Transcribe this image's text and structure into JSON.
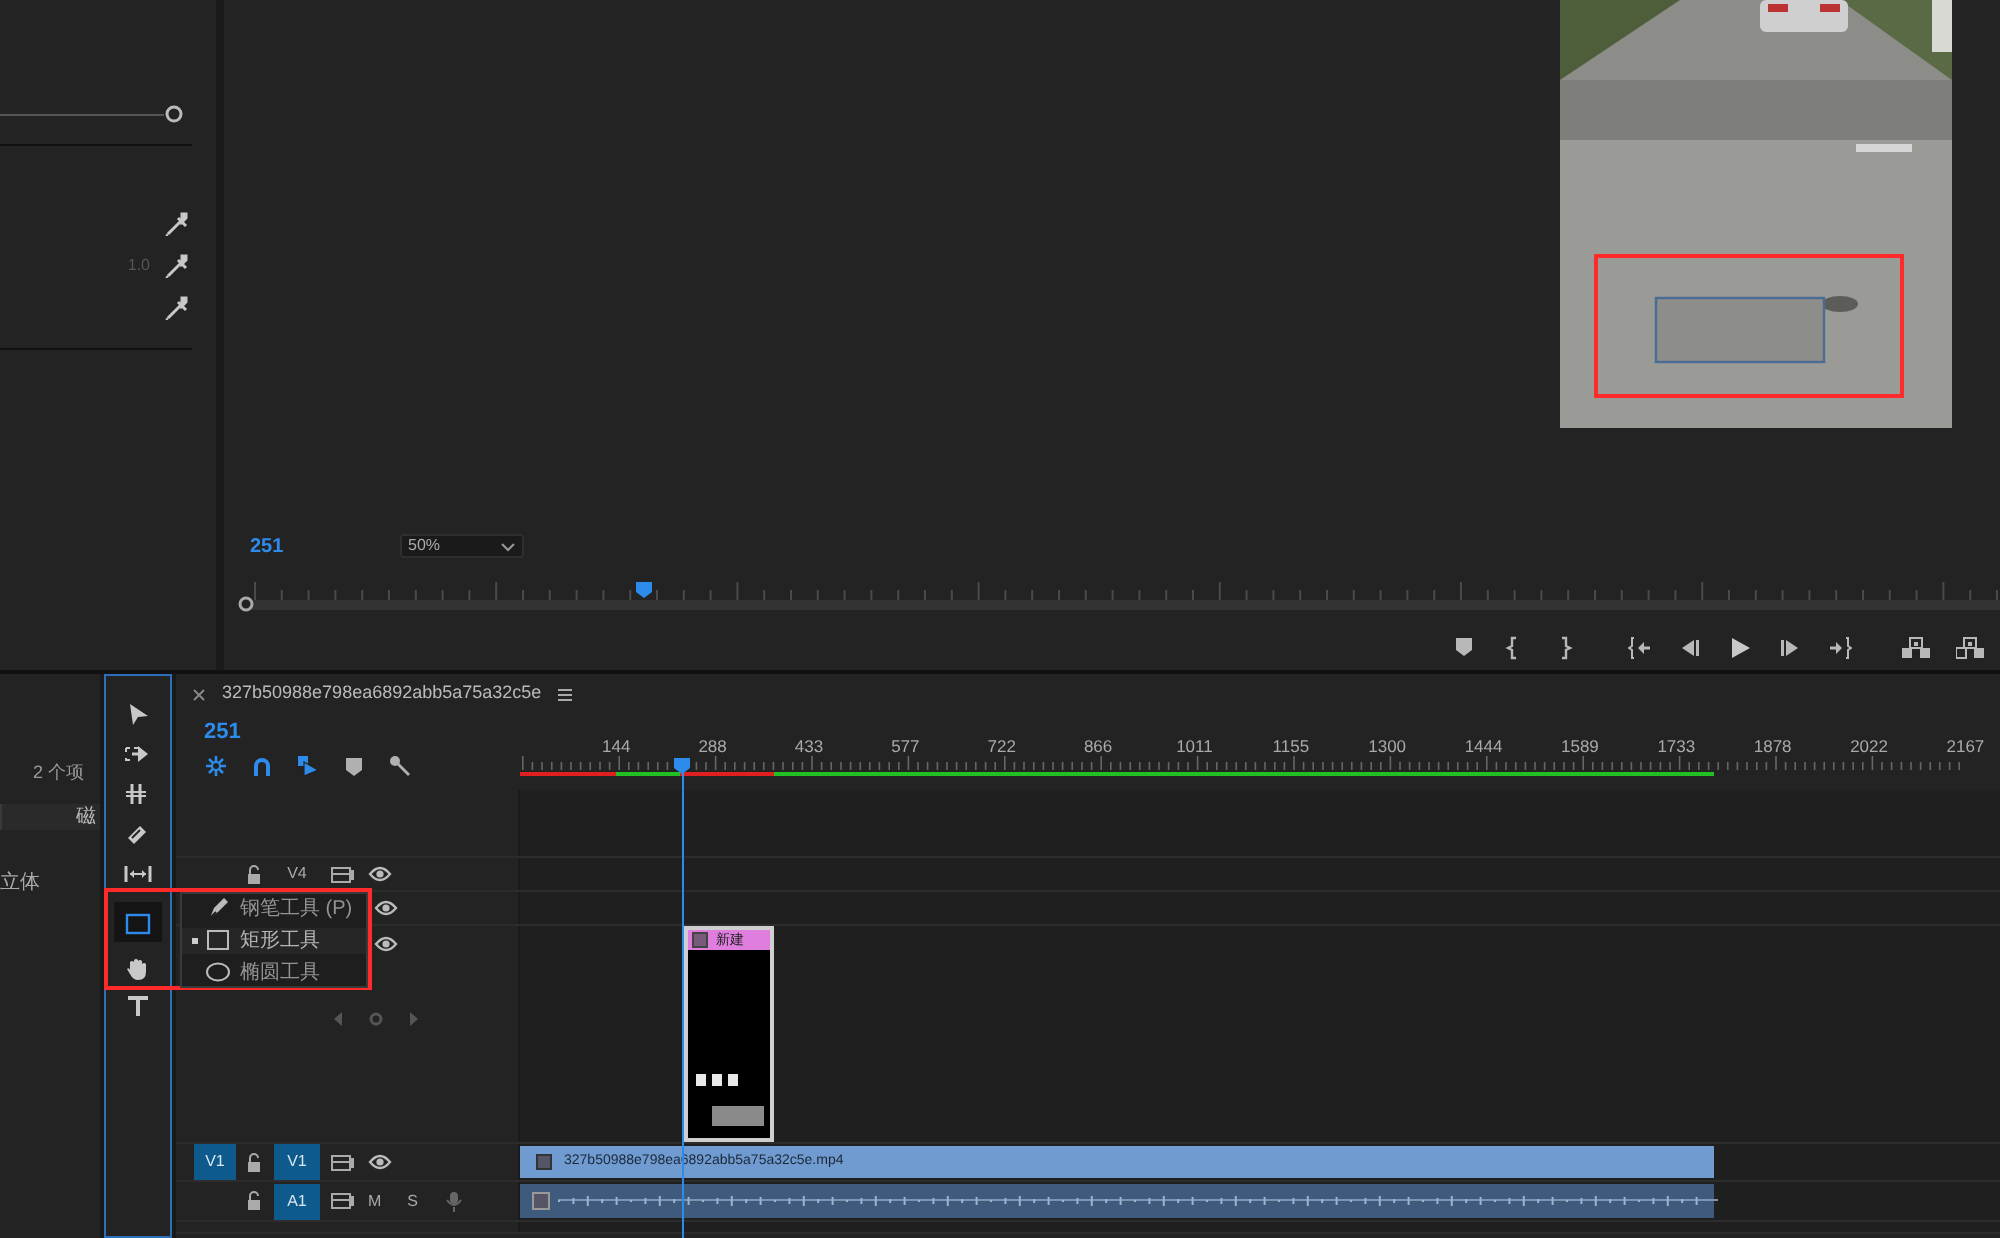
{
  "effect_controls": {
    "value": "1.0"
  },
  "program_monitor": {
    "timecode": "251",
    "zoom": "50%",
    "scrubber": {
      "level": 0.23
    },
    "controls": [
      {
        "kind": "marker"
      },
      {
        "kind": "mark-in"
      },
      {
        "kind": "mark-out"
      },
      {
        "kind": "go-to-in"
      },
      {
        "kind": "step-back"
      },
      {
        "kind": "play"
      },
      {
        "kind": "step-forward"
      },
      {
        "kind": "go-to-out"
      },
      {
        "kind": "lift"
      },
      {
        "kind": "extract"
      }
    ]
  },
  "project_panel": {
    "item_count": "2 个项",
    "column_header": "磁",
    "row_label": "立体"
  },
  "tools": [
    {
      "kind": "select",
      "selected": false
    },
    {
      "kind": "track-select",
      "selected": false
    },
    {
      "kind": "ripple",
      "selected": false
    },
    {
      "kind": "razor",
      "selected": false
    },
    {
      "kind": "slip",
      "selected": false
    },
    {
      "kind": "rectangle",
      "selected": true
    },
    {
      "kind": "hand",
      "selected": false
    },
    {
      "kind": "type",
      "selected": false
    }
  ],
  "tool_menu": [
    {
      "kind": "pen",
      "label": "钢笔工具 (P)",
      "selected": false
    },
    {
      "kind": "rectangle",
      "label": "矩形工具",
      "selected": true
    },
    {
      "kind": "ellipse",
      "label": "椭圆工具",
      "selected": false
    }
  ],
  "timeline": {
    "tab_title": "327b50988e798ea6892abb5a75a32c5e",
    "timecode": "251",
    "toolbar": [
      {
        "kind": "nest",
        "on": true
      },
      {
        "kind": "snap",
        "on": true
      },
      {
        "kind": "linked",
        "on": true
      },
      {
        "kind": "marker",
        "on": false
      },
      {
        "kind": "wrench",
        "on": false
      }
    ],
    "ruler": [
      "144",
      "288",
      "433",
      "577",
      "722",
      "866",
      "1011",
      "1155",
      "1300",
      "1444",
      "1589",
      "1733",
      "1878",
      "2022",
      "2167"
    ],
    "graphic_clip": {
      "label": "新建"
    },
    "tracks": [
      {
        "kind": "video",
        "name": "V4",
        "targeted": false
      },
      {
        "kind": "video",
        "source": "V1",
        "name": "V1",
        "targeted": true,
        "clip": "327b50988e798ea6892abb5a75a32c5e.mp4"
      },
      {
        "kind": "audio",
        "name": "A1",
        "targeted": true,
        "mute": "M",
        "solo": "S"
      }
    ]
  }
}
